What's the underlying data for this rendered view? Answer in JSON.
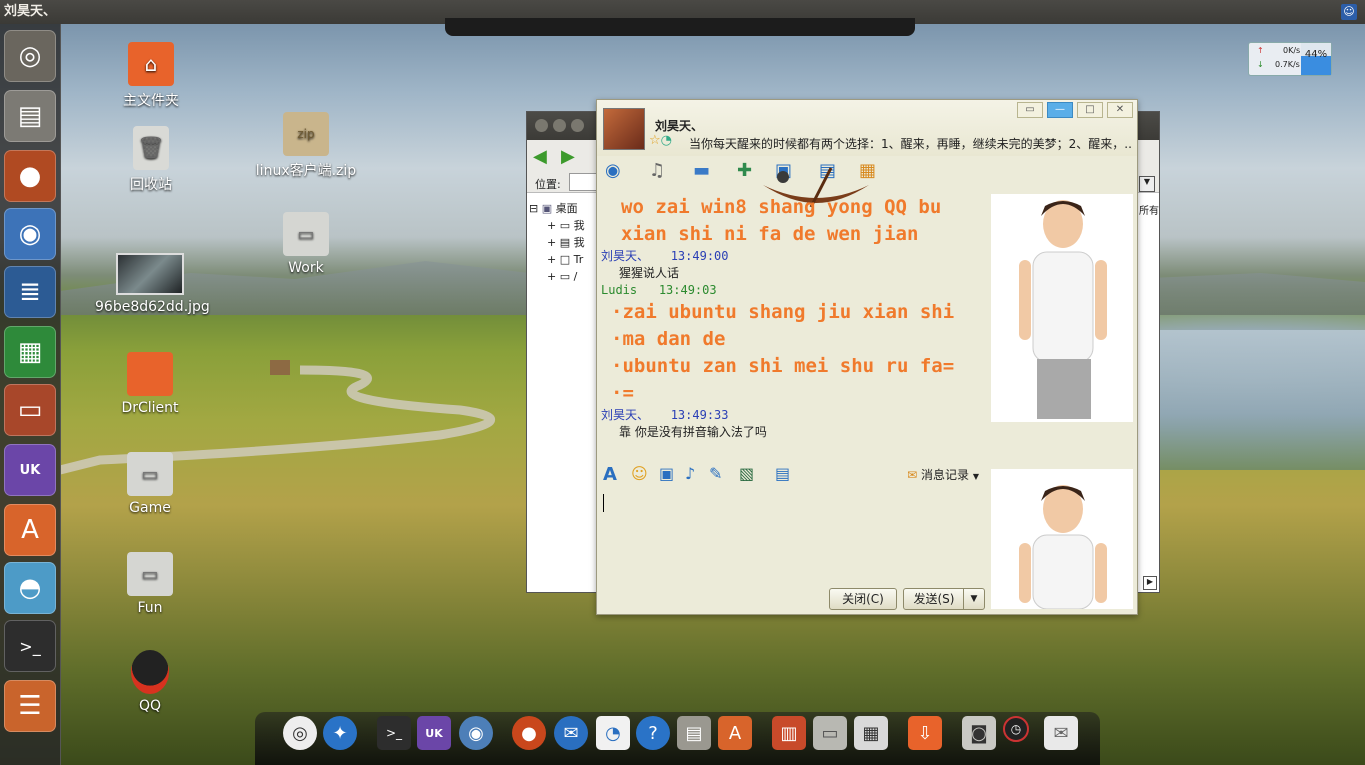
{
  "top_panel": {
    "title": "刘昊天、"
  },
  "desktop": {
    "icons": [
      {
        "label": "主文件夹",
        "icon": "home-folder-icon"
      },
      {
        "label": "回收站",
        "icon": "trash-icon"
      },
      {
        "label": "linux客户端.zip",
        "icon": "zip-archive-icon"
      },
      {
        "label": "Work",
        "icon": "drive-icon"
      },
      {
        "label": "96be8d62dd.jpg",
        "icon": "image-file-icon"
      },
      {
        "label": "DrClient",
        "icon": "folder-icon"
      },
      {
        "label": "Game",
        "icon": "drive-icon"
      },
      {
        "label": "Fun",
        "icon": "drive-icon"
      },
      {
        "label": "QQ",
        "icon": "qq-penguin-icon"
      }
    ]
  },
  "net_monitor": {
    "up": "0K/s",
    "down": "0.7K/s",
    "cpu": "44%"
  },
  "file_manager": {
    "location_label": "位置:",
    "column_hint": "所有",
    "tree": [
      {
        "label": "桌面",
        "toggle": "⊟"
      },
      {
        "label": "我",
        "toggle": "+"
      },
      {
        "label": "我",
        "toggle": "+"
      },
      {
        "label": "Tr",
        "toggle": "+"
      },
      {
        "label": "/",
        "toggle": "+"
      }
    ]
  },
  "qq_chat": {
    "contact_name": "刘昊天、",
    "signature": "当你每天醒来的时候都有两个选择：1、醒来，再睡，继续未完的美梦；2、醒来，...",
    "messages": [
      {
        "type": "big",
        "lines": [
          "wo zai win8 shang yong QQ bu",
          "xian shi ni fa de wen jian"
        ]
      },
      {
        "type": "head",
        "who": "me",
        "sender": "刘昊天、",
        "time": "13:49:00"
      },
      {
        "type": "body",
        "text": "猩猩说人话"
      },
      {
        "type": "head",
        "who": "peer",
        "sender": "Ludis",
        "time": "13:49:03"
      },
      {
        "type": "big",
        "bullet": true,
        "lines": [
          "zai ubuntu shang jiu xian shi",
          "ma dan de"
        ]
      },
      {
        "type": "big",
        "bullet": true,
        "lines": [
          "ubuntu zan shi mei shu ru fa=",
          "="
        ]
      },
      {
        "type": "head",
        "who": "me",
        "sender": "刘昊天、",
        "time": "13:49:33"
      },
      {
        "type": "body",
        "text": "靠 你是没有拼音输入法了吗"
      }
    ],
    "history_label": "消息记录",
    "close_button": "关闭(C)",
    "send_button": "发送(S)"
  },
  "launcher_apps": [
    "ubuntu-logo-icon",
    "files-icon",
    "firefox-icon",
    "chromium-icon",
    "writer-icon",
    "calc-icon",
    "impress-icon",
    "ubuntu-kylin-icon",
    "software-center-icon",
    "qq-client-icon",
    "terminal-icon",
    "stacked-apps-icon"
  ],
  "dock_apps": [
    "ubuntu-logo-icon",
    "accessibility-icon",
    "terminal-icon",
    "ubuntu-kylin-icon",
    "chromium-icon",
    "firefox-icon",
    "thunderbird-icon",
    "chat-icon",
    "help-icon",
    "files-icon",
    "software-center-icon",
    "document-viewer-icon",
    "drive-icon",
    "calculator-icon",
    "downloads-icon",
    "screenshot-icon",
    "clock-icon",
    "mail-icon"
  ]
}
